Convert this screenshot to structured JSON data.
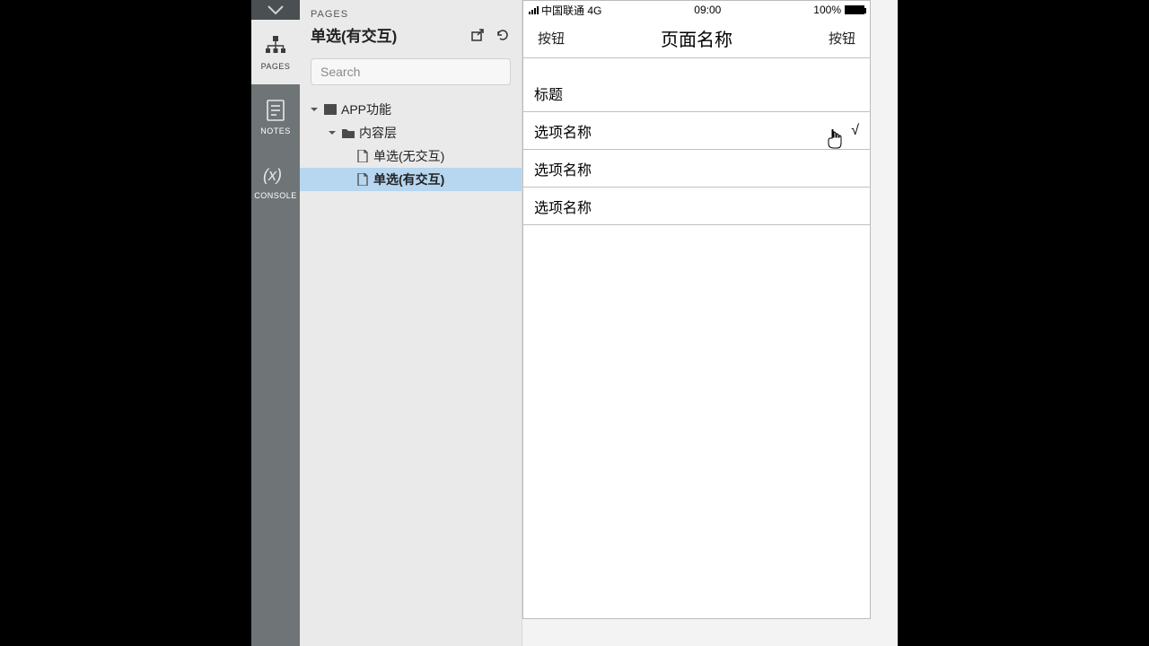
{
  "navrail": {
    "items": [
      {
        "label": "PAGES"
      },
      {
        "label": "NOTES"
      },
      {
        "label": "CONSOLE"
      }
    ]
  },
  "panel": {
    "title_small": "PAGES",
    "title_big": "单选(有交互)",
    "search_placeholder": "Search"
  },
  "tree": {
    "folder1": "APP功能",
    "folder2": "内容层",
    "page1": "单选(无交互)",
    "page2": "单选(有交互)"
  },
  "phone": {
    "statusbar": {
      "carrier": "中国联通 4G",
      "time": "09:00",
      "battery_pct": "100%"
    },
    "navbar": {
      "left": "按钮",
      "title": "页面名称",
      "right": "按钮"
    },
    "section_header": "标题",
    "options": [
      {
        "label": "选项名称",
        "checked": true
      },
      {
        "label": "选项名称",
        "checked": false
      },
      {
        "label": "选项名称",
        "checked": false
      }
    ],
    "check_mark": "√"
  }
}
